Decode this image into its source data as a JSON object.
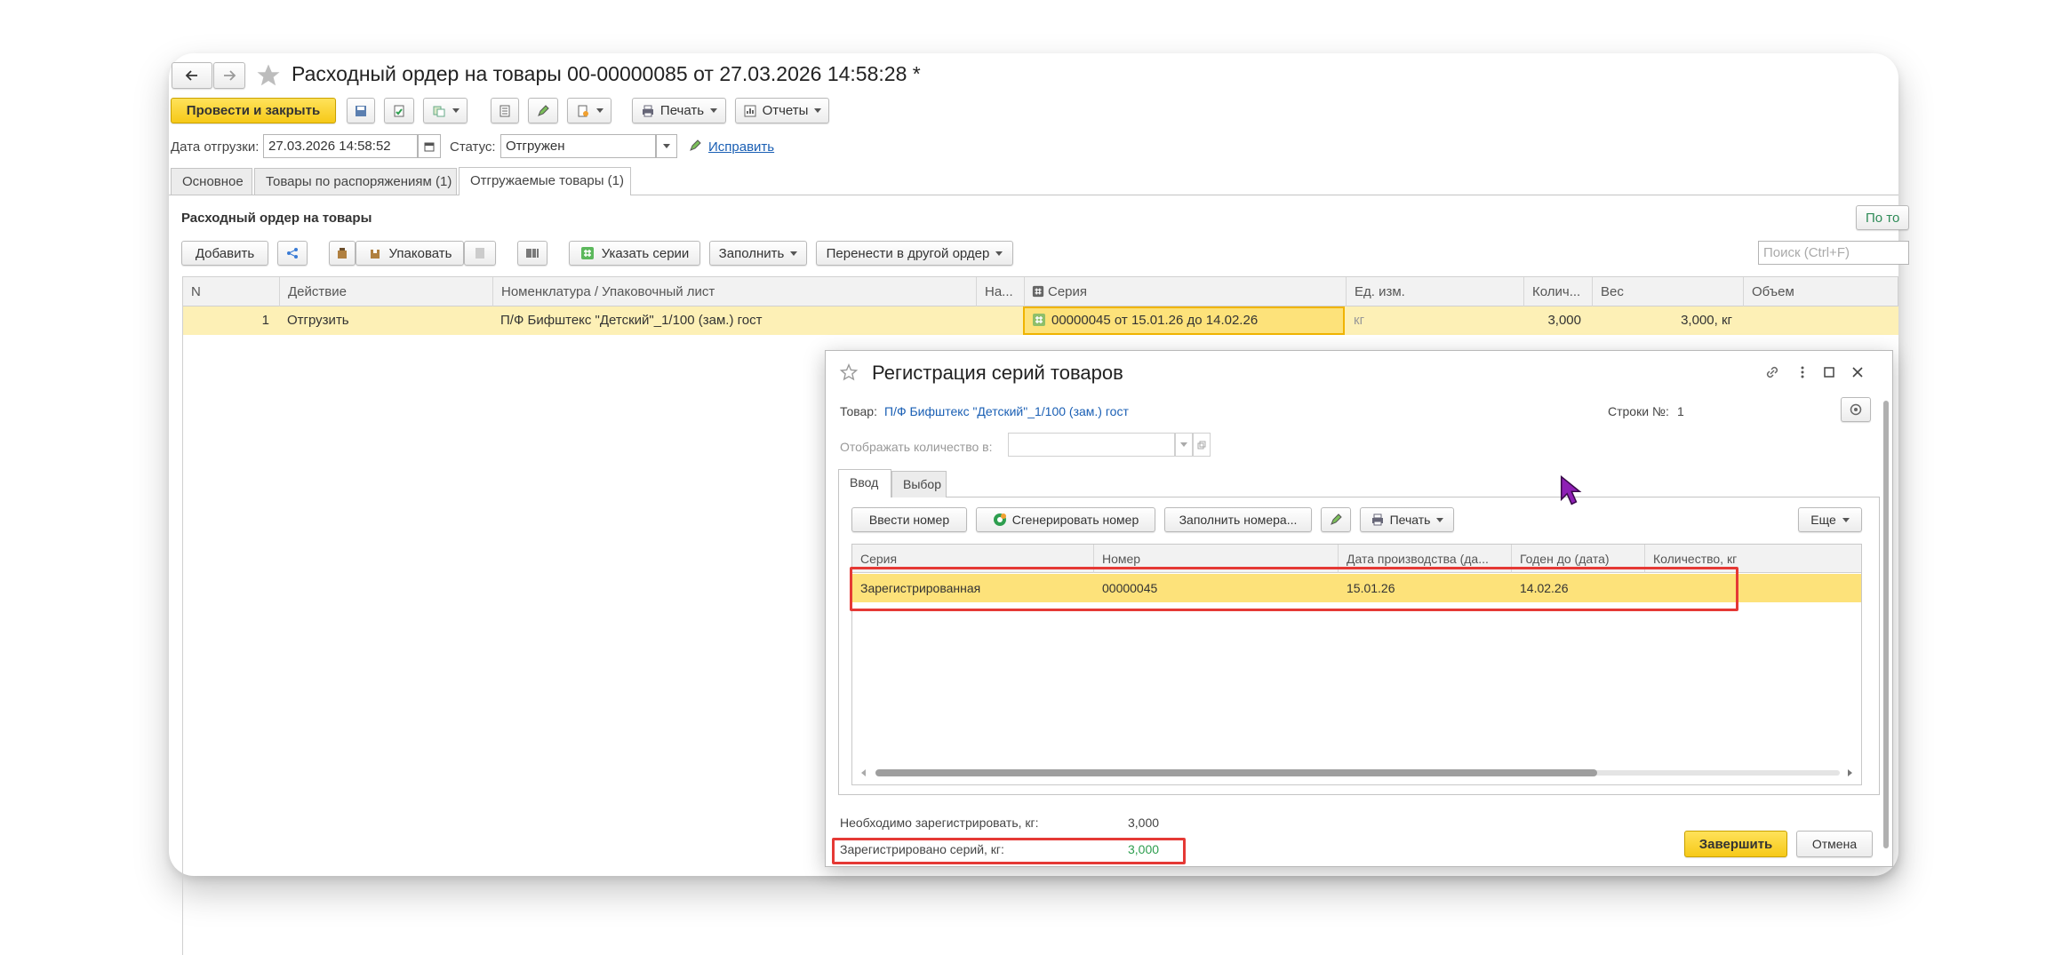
{
  "window": {
    "title": "Расходный ордер на товары 00-00000085 от 27.03.2026 14:58:28 *",
    "nav_back_icon": "arrow-left-icon",
    "nav_forward_icon": "arrow-right-icon",
    "favorite_icon": "star-icon"
  },
  "toolbar": {
    "post_and_close": "Провести и закрыть",
    "print": "Печать",
    "reports": "Отчеты"
  },
  "header_form": {
    "ship_date_label": "Дата отгрузки:",
    "ship_date_value": "27.03.2026 14:58:52",
    "status_label": "Статус:",
    "status_value": "Отгружен",
    "fix_link": "Исправить"
  },
  "tabs": [
    {
      "label": "Основное"
    },
    {
      "label": "Товары по распоряжениям (1)"
    },
    {
      "label": "Отгружаемые товары (1)"
    }
  ],
  "section": {
    "title": "Расходный ордер на товары",
    "right_button": "По то",
    "search_placeholder": "Поиск (Ctrl+F)"
  },
  "goods_toolbar": {
    "add": "Добавить",
    "pack": "Упаковать",
    "set_series": "Указать серии",
    "fill": "Заполнить",
    "move": "Перенести в другой ордер"
  },
  "goods_table": {
    "columns": [
      "N",
      "Действие",
      "Номенклатура / Упаковочный лист",
      "На...",
      "Серия",
      "Ед. изм.",
      "Колич...",
      "Вес",
      "Объем"
    ],
    "rows": [
      {
        "n": "1",
        "action": "Отгрузить",
        "item": "П/Ф Бифштекс \"Детский\"_1/100 (зам.) гост",
        "na": "",
        "series": "00000045 от 15.01.26 до 14.02.26",
        "unit": "кг",
        "qty": "3,000",
        "weight": "3,000, кг",
        "volume": ""
      }
    ]
  },
  "dialog": {
    "title": "Регистрация серий товаров",
    "product_label": "Товар:",
    "product_value": "П/Ф Бифштекс \"Детский\"_1/100 (зам.) гост",
    "rows_label": "Строки №:",
    "rows_value": "1",
    "display_qty_label": "Отображать количество в:",
    "tabs": [
      {
        "label": "Ввод"
      },
      {
        "label": "Выбор"
      }
    ],
    "buttons": {
      "enter_number": "Ввести номер",
      "generate_number": "Сгенерировать номер",
      "fill_numbers": "Заполнить номера...",
      "print": "Печать",
      "more": "Еще",
      "finish": "Завершить",
      "cancel": "Отмена"
    },
    "table": {
      "columns": [
        "Серия",
        "Номер",
        "Дата производства (да...",
        "Годен до (дата)",
        "Количество, кг"
      ],
      "rows": [
        {
          "series": "Зарегистрированная",
          "number": "00000045",
          "production_date": "15.01.26",
          "expiry": "14.02.26",
          "qty": ""
        }
      ]
    },
    "need_register_label": "Необходимо зарегистрировать, кг:",
    "need_register_value": "3,000",
    "registered_label": "Зарегистрировано серий, кг:",
    "registered_value": "3,000"
  },
  "colors": {
    "accent_yellow": "#f6c918",
    "row_highlight": "#fdf0b6",
    "cell_selected": "#fde27a",
    "annotation_red": "#e53935",
    "link_blue": "#1a5fb4",
    "cursor_purple": "#8e1fb5",
    "registered_green": "#2e9e4f"
  }
}
